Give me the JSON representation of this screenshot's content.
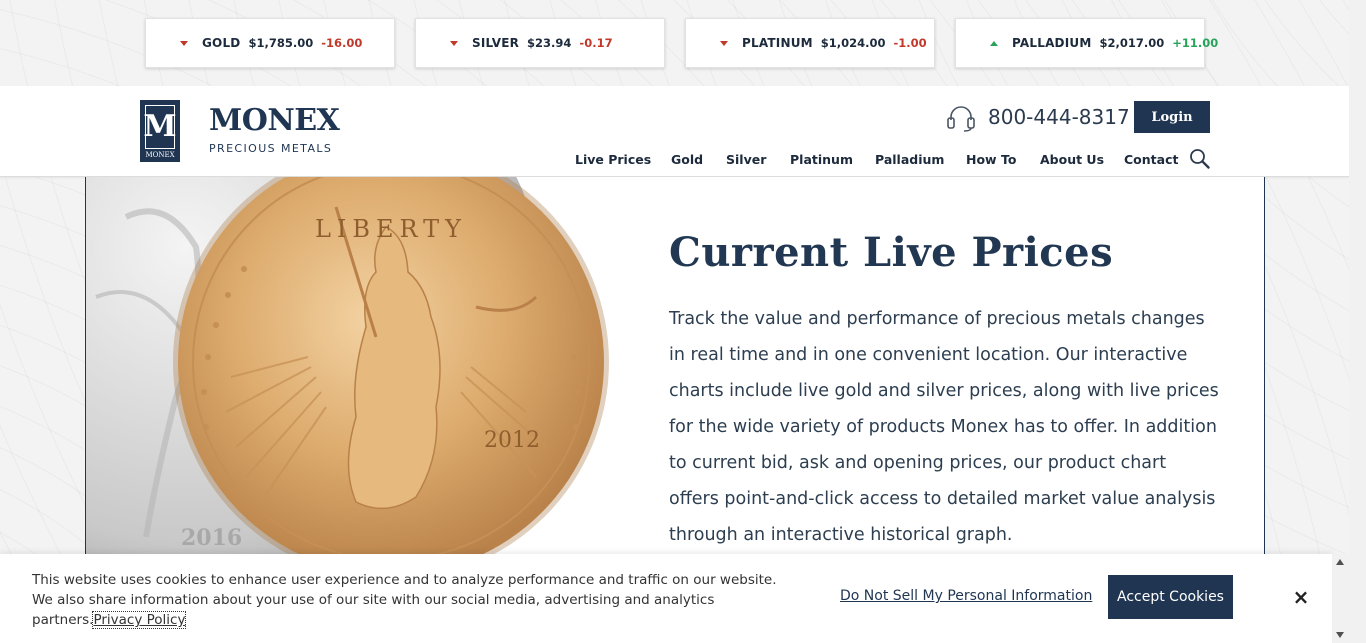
{
  "ticker": [
    {
      "name": "GOLD",
      "price": "$1,785.00",
      "change": "-16.00",
      "direction": "down"
    },
    {
      "name": "SILVER",
      "price": "$23.94",
      "change": "-0.17",
      "direction": "down"
    },
    {
      "name": "PLATINUM",
      "price": "$1,024.00",
      "change": "-1.00",
      "direction": "down"
    },
    {
      "name": "PALLADIUM",
      "price": "$2,017.00",
      "change": "+11.00",
      "direction": "up"
    }
  ],
  "header": {
    "logo_letter": "M",
    "logo_small": "MONEX",
    "logo_word": "MONEX",
    "logo_sub": "PRECIOUS METALS",
    "phone": "800-444-8317",
    "login_label": "Login"
  },
  "nav": [
    {
      "label": "Live Prices"
    },
    {
      "label": "Gold"
    },
    {
      "label": "Silver"
    },
    {
      "label": "Platinum"
    },
    {
      "label": "Palladium"
    },
    {
      "label": "How To"
    },
    {
      "label": "About Us"
    },
    {
      "label": "Contact"
    }
  ],
  "hero": {
    "coin_legend": "LIBERTY",
    "coin_year": "2012",
    "silver_coin_year": "2016"
  },
  "main": {
    "title": "Current Live Prices",
    "description": "Track the value and performance of precious metals changes in real time and in one convenient location. Our interactive charts include live gold and silver prices, along with live prices for the wide variety of products Monex has to offer. In addition to current bid, ask and opening prices, our product chart offers point-and-click access to detailed market value analysis through an interactive historical graph."
  },
  "cookie": {
    "text": "This website uses cookies to enhance user experience and to analyze performance and traffic on our website. We also share information about your use of our site with our social media, advertising and analytics partners.",
    "privacy_label": "Privacy Policy",
    "do_not_sell_label": "Do Not Sell My Personal Information",
    "accept_label": "Accept Cookies",
    "close_label": "×"
  },
  "colors": {
    "brand_navy": "#1f3552",
    "negative": "#c0392b",
    "positive": "#27a35a",
    "gold": "#d9a86a"
  },
  "icons": {
    "phone": "headset-icon",
    "search": "search-icon",
    "close": "close-icon",
    "down": "caret-down-icon",
    "up": "caret-up-icon"
  }
}
